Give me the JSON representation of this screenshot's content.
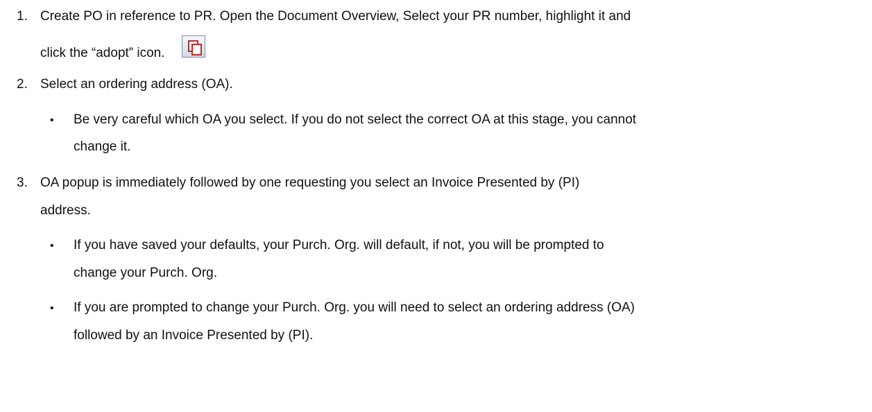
{
  "steps": [
    {
      "number": "1.",
      "line1": "Create PO in reference to PR. Open the Document Overview, Select your PR number, highlight it and",
      "line2": "click the “adopt” icon.",
      "icon": "adopt-icon"
    },
    {
      "number": "2.",
      "line1": "Select an ordering address (OA).",
      "bullets": [
        {
          "line1": "Be very careful which OA you select. If you do not select the correct OA at this stage, you cannot",
          "line2": "change it."
        }
      ]
    },
    {
      "number": "3.",
      "line1": "OA popup is immediately followed by one requesting you select an Invoice Presented by (PI)",
      "line2": "address.",
      "bullets": [
        {
          "line1": "If you have saved your defaults, your Purch. Org. will default, if not, you will be prompted to",
          "line2": "change your Purch. Org."
        },
        {
          "line1": "If you are prompted to change your Purch. Org. you will need to select an ordering address (OA)",
          "line2": "followed by an Invoice Presented by (PI)."
        }
      ]
    }
  ],
  "bullet_glyph": "•"
}
